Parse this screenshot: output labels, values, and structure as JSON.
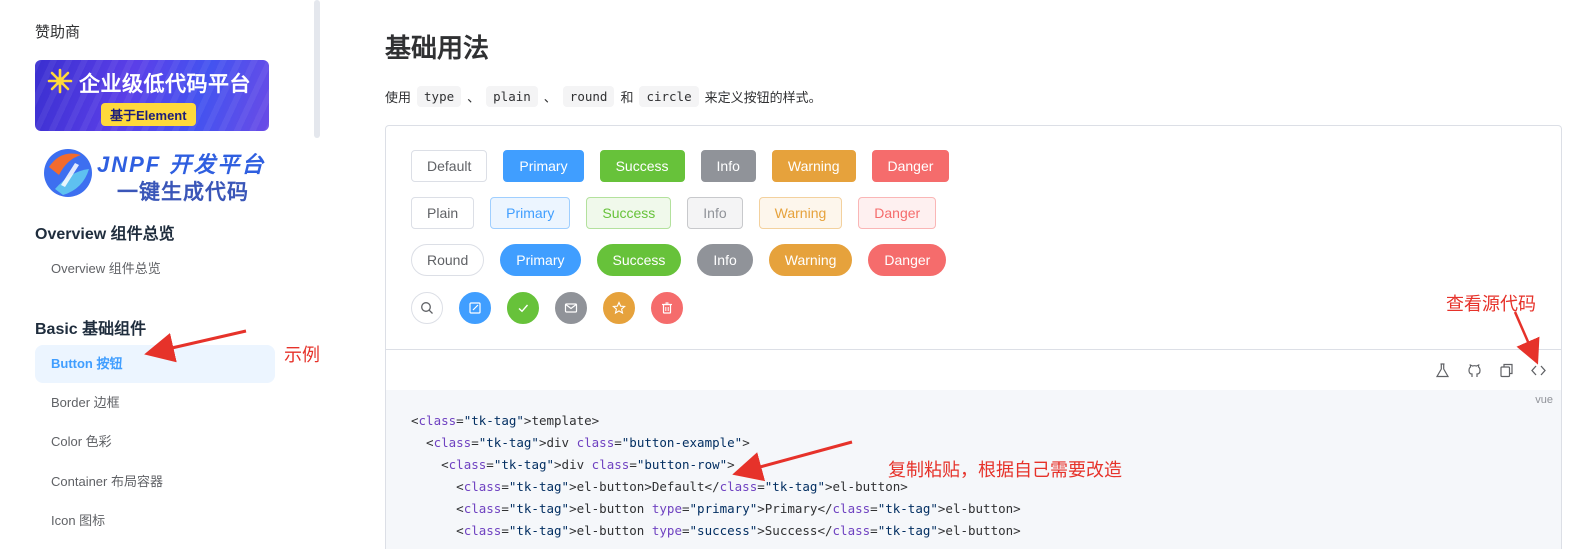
{
  "sidebar": {
    "sponsor_title": "赞助商",
    "sponsor1": {
      "title": "企业级低代码平台",
      "tag": "基于Element"
    },
    "sponsor2": {
      "title": "JNPF 开发平台",
      "subtitle": "一键生成代码"
    },
    "groups": [
      {
        "title": "Overview 组件总览",
        "items": [
          "Overview 组件总览"
        ]
      },
      {
        "title": "Basic 基础组件",
        "items": [
          "Button 按钮",
          "Border 边框",
          "Color 色彩",
          "Container 布局容器",
          "Icon 图标"
        ]
      }
    ],
    "active_item": "Button 按钮"
  },
  "annotations": {
    "example": "示例",
    "view_source": "查看源代码",
    "copy_paste": "复制粘贴，根据自己需要改造"
  },
  "main": {
    "title": "基础用法",
    "desc_prefix": "使用",
    "desc_codes": [
      "type",
      "plain",
      "round",
      "circle"
    ],
    "desc_sep": "、",
    "desc_and": "和",
    "desc_suffix": "来定义按钮的样式。",
    "rows": {
      "default": [
        "Default",
        "Primary",
        "Success",
        "Info",
        "Warning",
        "Danger"
      ],
      "plain": [
        "Plain",
        "Primary",
        "Success",
        "Info",
        "Warning",
        "Danger"
      ],
      "round": [
        "Round",
        "Primary",
        "Success",
        "Info",
        "Warning",
        "Danger"
      ],
      "circle_icons": [
        "search-icon",
        "edit-icon",
        "check-icon",
        "message-icon",
        "star-icon",
        "delete-icon"
      ]
    },
    "toolbar_icons": [
      "playground-icon",
      "github-icon",
      "copy-icon",
      "code-icon"
    ],
    "code_lang": "vue",
    "code_lines": [
      "<template>",
      "  <div class=\"button-example\">",
      "    <div class=\"button-row\">",
      "      <el-button>Default</el-button>",
      "      <el-button type=\"primary\">Primary</el-button>",
      "      <el-button type=\"success\">Success</el-button>"
    ]
  },
  "colors": {
    "primary": "#409eff",
    "success": "#67c23a",
    "info": "#909399",
    "warning": "#e6a23c",
    "danger": "#f56c6c",
    "annotation": "#e6322a"
  }
}
